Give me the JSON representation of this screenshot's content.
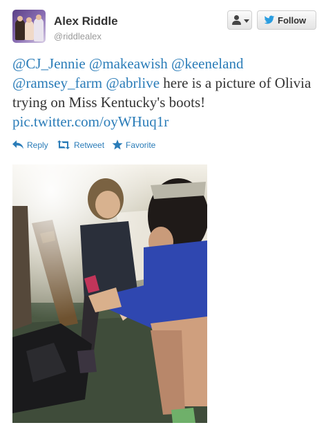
{
  "user": {
    "name": "Alex Riddle",
    "handle": "@riddlealex"
  },
  "buttons": {
    "user_icon": "user-icon",
    "follow_label": "Follow"
  },
  "tweet": {
    "mentions": [
      "@CJ_Jennie",
      "@makeawish",
      "@keeneland",
      "@ramsey_farm",
      "@abrlive"
    ],
    "text": "here is a picture of Olivia trying on Miss Kentucky's boots!",
    "link": "pic.twitter.com/oyWHuq1r"
  },
  "actions": [
    {
      "label": "Reply",
      "icon": "reply-icon"
    },
    {
      "label": "Retweet",
      "icon": "retweet-icon"
    },
    {
      "label": "Favorite",
      "icon": "star-icon"
    }
  ],
  "colors": {
    "link": "#2a7cb8",
    "name": "#333333",
    "handle": "#999999"
  }
}
